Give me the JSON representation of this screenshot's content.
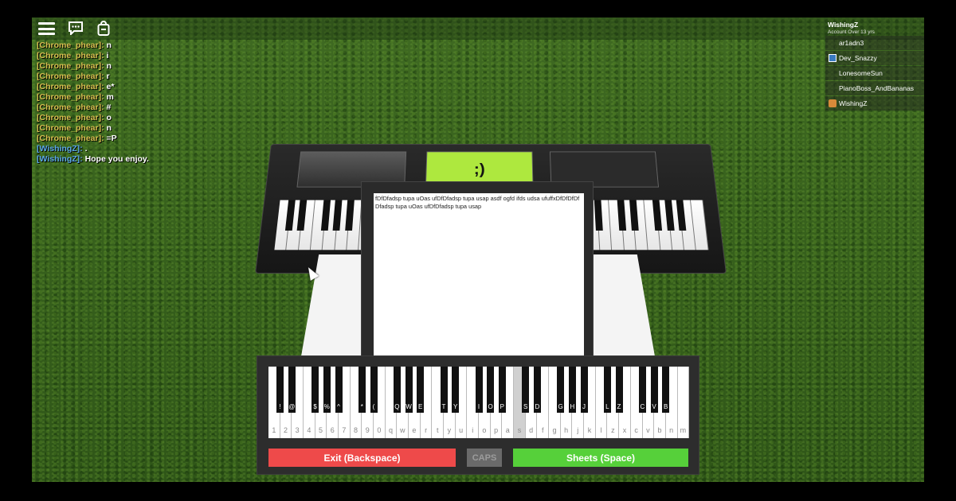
{
  "topbar": {
    "menu_icon": "hamburger-menu-icon",
    "chat_icon": "chat-icon",
    "backpack_icon": "backpack-icon"
  },
  "chat": [
    {
      "user": "[Chrome_phear]:",
      "msg": "n",
      "self": false
    },
    {
      "user": "[Chrome_phear]:",
      "msg": "i",
      "self": false
    },
    {
      "user": "[Chrome_phear]:",
      "msg": "n",
      "self": false
    },
    {
      "user": "[Chrome_phear]:",
      "msg": "r",
      "self": false
    },
    {
      "user": "[Chrome_phear]:",
      "msg": "e*",
      "self": false
    },
    {
      "user": "[Chrome_phear]:",
      "msg": "m",
      "self": false
    },
    {
      "user": "[Chrome_phear]:",
      "msg": "#",
      "self": false
    },
    {
      "user": "[Chrome_phear]:",
      "msg": "o",
      "self": false
    },
    {
      "user": "[Chrome_phear]:",
      "msg": "n",
      "self": false
    },
    {
      "user": "[Chrome_phear]:",
      "msg": "=P",
      "self": false
    },
    {
      "user": "[WishingZ]:",
      "msg": ".",
      "self": true
    },
    {
      "user": "[WishingZ]:",
      "msg": "Hope you enjoy.",
      "self": true
    }
  ],
  "player_list": {
    "username": "WishingZ",
    "account_info": "Account Over 13 yrs",
    "players": [
      {
        "name": "ar1adn3",
        "icon": "none"
      },
      {
        "name": "Dev_Snazzy",
        "icon": "dev-badge-icon"
      },
      {
        "name": "LonesomeSun",
        "icon": "none"
      },
      {
        "name": "PianoBoss_AndBananas",
        "icon": "none"
      },
      {
        "name": "WishingZ",
        "icon": "premium-badge-icon"
      }
    ]
  },
  "keyboard_display": {
    "center_pad_text": ";)"
  },
  "sheet": {
    "text": "fDfDfadsp tupa uOas ufDfDfadsp tupa usap asdf ogfd ifds udsa ufuffxDfDfDfDfDfadsp tupa uOas ufDfDfadsp tupa usap"
  },
  "piano": {
    "white_keys": [
      "1",
      "2",
      "3",
      "4",
      "5",
      "6",
      "7",
      "8",
      "9",
      "0",
      "q",
      "w",
      "e",
      "r",
      "t",
      "y",
      "u",
      "i",
      "o",
      "p",
      "a",
      "s",
      "d",
      "f",
      "g",
      "h",
      "j",
      "k",
      "l",
      "z",
      "x",
      "c",
      "v",
      "b",
      "n",
      "m"
    ],
    "pressed_key": "s",
    "black_keys": [
      {
        "after": 0,
        "label": "!"
      },
      {
        "after": 1,
        "label": "@"
      },
      {
        "after": 3,
        "label": "$"
      },
      {
        "after": 4,
        "label": "%"
      },
      {
        "after": 5,
        "label": "^"
      },
      {
        "after": 7,
        "label": "*"
      },
      {
        "after": 8,
        "label": "("
      },
      {
        "after": 10,
        "label": "Q"
      },
      {
        "after": 11,
        "label": "W"
      },
      {
        "after": 12,
        "label": "E"
      },
      {
        "after": 14,
        "label": "T"
      },
      {
        "after": 15,
        "label": "Y"
      },
      {
        "after": 17,
        "label": "I"
      },
      {
        "after": 18,
        "label": "O"
      },
      {
        "after": 19,
        "label": "P"
      },
      {
        "after": 21,
        "label": "S"
      },
      {
        "after": 22,
        "label": "D"
      },
      {
        "after": 24,
        "label": "G"
      },
      {
        "after": 25,
        "label": "H"
      },
      {
        "after": 26,
        "label": "J"
      },
      {
        "after": 28,
        "label": "L"
      },
      {
        "after": 29,
        "label": "Z"
      },
      {
        "after": 31,
        "label": "C"
      },
      {
        "after": 32,
        "label": "V"
      },
      {
        "after": 33,
        "label": "B"
      }
    ]
  },
  "buttons": {
    "exit": "Exit (Backspace)",
    "caps": "CAPS",
    "sheets": "Sheets (Space)"
  },
  "colors": {
    "exit": "#ee4a4a",
    "sheets": "#56d03a",
    "caps": "#6a6a6a",
    "pad_green": "#aee83e"
  }
}
